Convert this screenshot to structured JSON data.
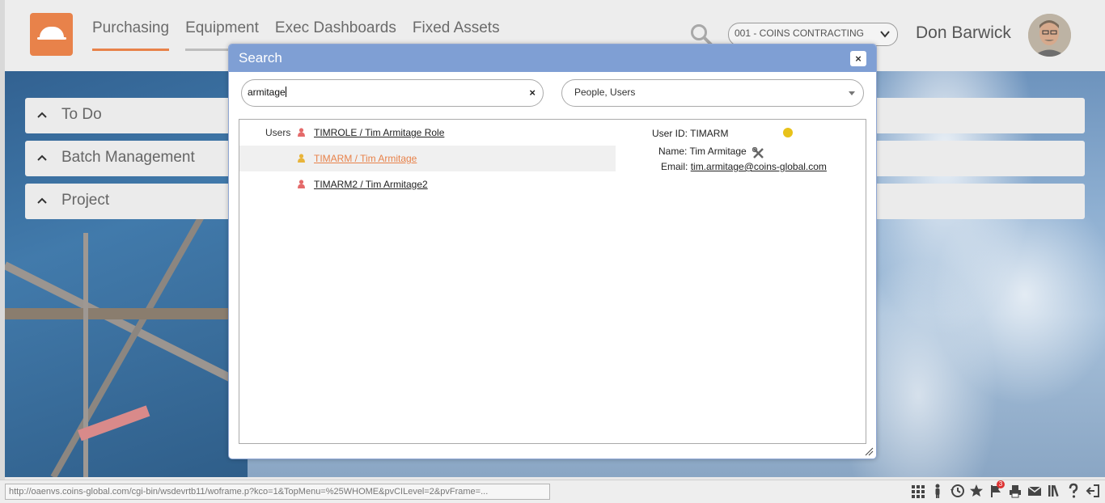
{
  "header": {
    "nav": [
      "Purchasing",
      "Equipment",
      "Exec Dashboards",
      "Fixed Assets"
    ],
    "company": "001 - COINS CONTRACTING",
    "user_name": "Don Barwick"
  },
  "panels": [
    "To Do",
    "Batch Management",
    "Project"
  ],
  "modal": {
    "title": "Search",
    "close": "×",
    "search_value": "armitage",
    "clear": "×",
    "type_value": "People, Users",
    "group_label": "Users",
    "results": [
      {
        "label": "TIMROLE / Tim Armitage Role",
        "icon_color": "#e46a6a"
      },
      {
        "label": "TIMARM / Tim Armitage",
        "icon_color": "#e8b43a",
        "selected": true
      },
      {
        "label": "TIMARM2 / Tim Armitage2",
        "icon_color": "#e46a6a"
      }
    ],
    "detail": {
      "user_id_label": "User ID:",
      "user_id": "TIMARM",
      "name_label": "Name:",
      "name": "Tim Armitage",
      "email_label": "Email:",
      "email": "tim.armitage@coins-global.com",
      "status_color": "#e8c21a"
    }
  },
  "status_bar": {
    "url": "http://oaenvs.coins-global.com/cgi-bin/wsdevrtb11/woframe.p?kco=1&TopMenu=%25WHOME&pvCILevel=2&pvFrame=...",
    "notification_count": "3"
  },
  "colors": {
    "accent": "#e8824a",
    "modal_header": "#7f9fd4"
  }
}
